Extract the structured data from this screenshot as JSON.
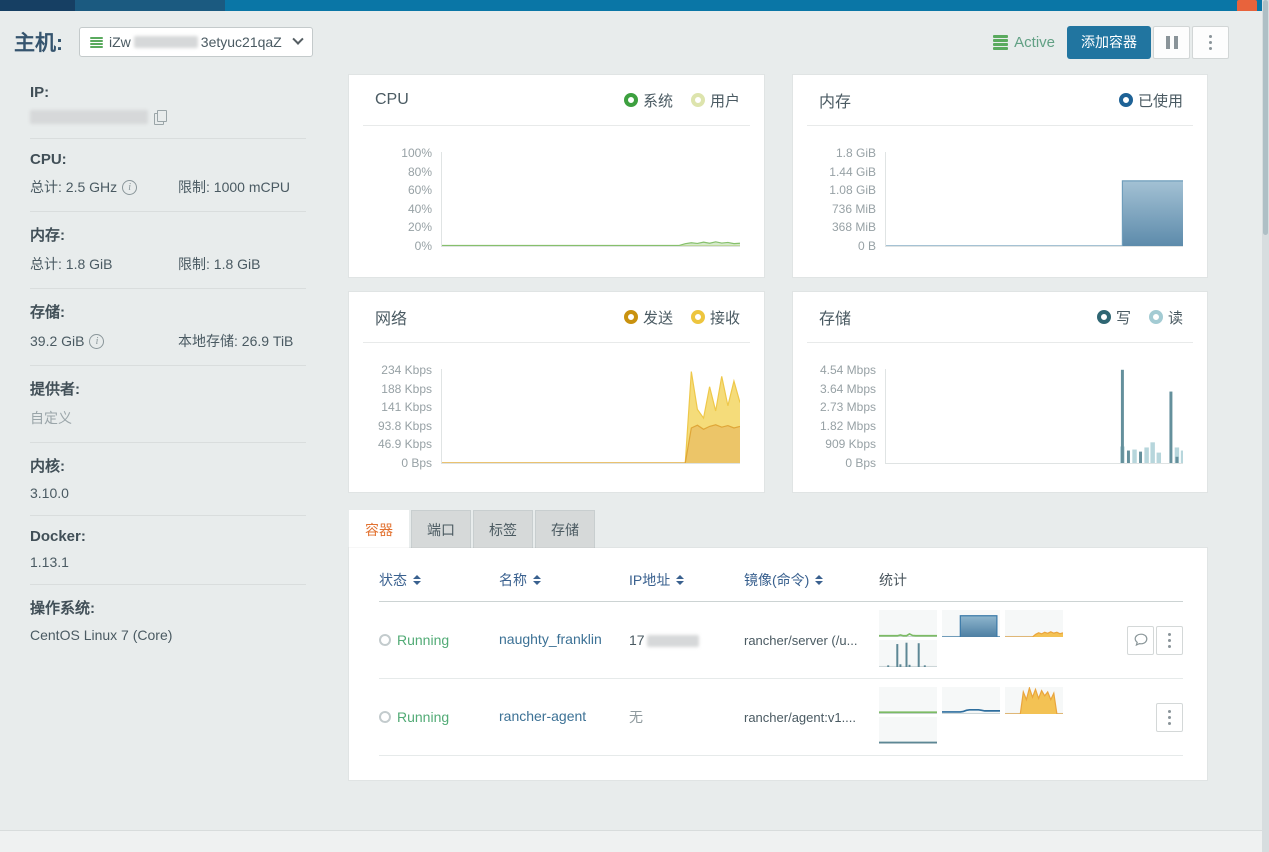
{
  "header": {
    "title": "主机:",
    "host_selector": {
      "icon": "host-stack-icon",
      "text_prefix": "iZw",
      "text_suffix": "3etyuc21qaZ"
    },
    "status_label": "Active",
    "add_container_label": "添加容器"
  },
  "sidebar": {
    "sections": [
      {
        "label": "IP:",
        "value1": "",
        "value2": ""
      },
      {
        "label": "CPU:",
        "value1": "总计: 2.5 GHz",
        "value2": "限制: 1000 mCPU"
      },
      {
        "label": "内存:",
        "value1": "总计: 1.8 GiB",
        "value2": "限制: 1.8 GiB"
      },
      {
        "label": "存储:",
        "value1": "39.2 GiB",
        "value2": "本地存储: 26.9 TiB"
      },
      {
        "label": "提供者:",
        "value1": "自定义",
        "value2": ""
      },
      {
        "label": "内核:",
        "value1": "3.10.0",
        "value2": ""
      },
      {
        "label": "Docker:",
        "value1": "1.13.1",
        "value2": ""
      },
      {
        "label": "操作系统:",
        "value1": "CentOS Linux 7 (Core)",
        "value2": ""
      }
    ]
  },
  "chart_data": [
    {
      "name": "cpu",
      "type": "area-line",
      "title": "CPU",
      "legend": [
        {
          "label": "系统",
          "color": "#3da03f"
        },
        {
          "label": "用户",
          "color": "#dde4ad"
        }
      ],
      "yticks": [
        "100%",
        "80%",
        "60%",
        "40%",
        "20%",
        "0%"
      ],
      "ymax": 100,
      "ylabel_unit": "%",
      "series": [
        {
          "name": "系统",
          "color": "#86c06c",
          "fill": "rgba(134,192,108,0.35)",
          "values": [
            0.6,
            0.6,
            0.6,
            0.6,
            0.6,
            0.6,
            0.6,
            0.6,
            0.6,
            0.6,
            0.6,
            0.6,
            0.6,
            0.6,
            0.6,
            0.6,
            0.6,
            0.6,
            0.6,
            0.6,
            0.6,
            0.6,
            0.6,
            0.6,
            0.6,
            0.6,
            0.6,
            0.6,
            0.6,
            0.6,
            0.6,
            0.6,
            0.6,
            0.6,
            0.6,
            0.6,
            0.6,
            0.6,
            0.6,
            0.6,
            2.5,
            3.5,
            2.8,
            4.2,
            3,
            4.5,
            3.2,
            3.8,
            2.6,
            3
          ]
        },
        {
          "name": "用户",
          "color": "#d7e3a8",
          "fill": "rgba(215,227,168,0.5)",
          "values": [
            0.3,
            0.3,
            0.3,
            0.3,
            0.3,
            0.3,
            0.3,
            0.3,
            0.3,
            0.3,
            0.3,
            0.3,
            0.3,
            0.3,
            0.3,
            0.3,
            0.3,
            0.3,
            0.3,
            0.3,
            0.3,
            0.3,
            0.3,
            0.3,
            0.3,
            0.3,
            0.3,
            0.3,
            0.3,
            0.3,
            0.3,
            0.3,
            0.3,
            0.3,
            0.3,
            0.3,
            0.3,
            0.3,
            0.3,
            0.3,
            0.3,
            0.3,
            0.3,
            0.3,
            0.3,
            0.3,
            0.3,
            0.3,
            0.3,
            0.3
          ]
        }
      ]
    },
    {
      "name": "memory",
      "type": "area",
      "title": "内存",
      "legend": [
        {
          "label": "已使用",
          "color": "#1e6296"
        }
      ],
      "yticks": [
        "1.8 GiB",
        "1.44 GiB",
        "1.08 GiB",
        "736 MiB",
        "368 MiB",
        "0 B"
      ],
      "ymax": 1843,
      "ylabel_unit": "MiB",
      "series": [
        {
          "name": "已使用",
          "color": "#6f9dbb",
          "fill": "gradient-blue",
          "step": true,
          "values": [
            0,
            0,
            0,
            0,
            0,
            0,
            0,
            0,
            0,
            0,
            0,
            0,
            0,
            0,
            0,
            0,
            0,
            0,
            0,
            0,
            0,
            0,
            0,
            0,
            0,
            0,
            0,
            0,
            0,
            0,
            0,
            0,
            0,
            0,
            0,
            0,
            0,
            0,
            0,
            1290,
            1290,
            1290,
            1290,
            1290,
            1290,
            1290,
            1290,
            1290,
            1290,
            1290
          ]
        }
      ]
    },
    {
      "name": "network",
      "type": "stacked-area",
      "title": "网络",
      "legend": [
        {
          "label": "发送",
          "color": "#c9920f"
        },
        {
          "label": "接收",
          "color": "#edc53e"
        }
      ],
      "yticks": [
        "234 Kbps",
        "188 Kbps",
        "141 Kbps",
        "93.8 Kbps",
        "46.9 Kbps",
        "0 Bps"
      ],
      "ymax": 234,
      "ylabel_unit": "Kbps",
      "series": [
        {
          "name": "发送",
          "color": "#dfa637",
          "fill": "#ecc568",
          "values": [
            0,
            0,
            0,
            0,
            0,
            0,
            0,
            0,
            0,
            0,
            0,
            0,
            0,
            0,
            0,
            0,
            0,
            0,
            0,
            0,
            0,
            0,
            0,
            0,
            0,
            0,
            0,
            0,
            0,
            0,
            0,
            0,
            0,
            0,
            0,
            0,
            0,
            0,
            0,
            0,
            0,
            88,
            95,
            85,
            92,
            96,
            90,
            94,
            88,
            92
          ]
        },
        {
          "name": "接收",
          "color": "#eec84a",
          "fill": "#f5dc7a",
          "values": [
            0,
            0,
            0,
            0,
            0,
            0,
            0,
            0,
            0,
            0,
            0,
            0,
            0,
            0,
            0,
            0,
            0,
            0,
            0,
            0,
            0,
            0,
            0,
            0,
            0,
            0,
            0,
            0,
            0,
            0,
            0,
            0,
            0,
            0,
            0,
            0,
            0,
            0,
            0,
            0,
            0,
            142,
            40,
            28,
            100,
            35,
            128,
            50,
            118,
            60
          ]
        }
      ]
    },
    {
      "name": "storage",
      "type": "spikes",
      "title": "存储",
      "legend": [
        {
          "label": "写",
          "color": "#2f6673"
        },
        {
          "label": "读",
          "color": "#a3cbd3"
        }
      ],
      "yticks": [
        "4.54 Mbps",
        "3.64 Mbps",
        "2.73 Mbps",
        "1.82 Mbps",
        "909 Kbps",
        "0 Bps"
      ],
      "ymax": 4.54,
      "ylabel_unit": "Mbps",
      "series": [
        {
          "name": "写",
          "color": "#64909c",
          "values": [
            0,
            0,
            0,
            0,
            0,
            0,
            0,
            0,
            0,
            0,
            0,
            0,
            0,
            0,
            0,
            0,
            0,
            0,
            0,
            0,
            0,
            0,
            0,
            0,
            0,
            0,
            0,
            0,
            0,
            0,
            0,
            0,
            0,
            0,
            0,
            0,
            0,
            0,
            0,
            4.5,
            0.6,
            0,
            0.55,
            0,
            0,
            0,
            0,
            3.45,
            0.3,
            0
          ]
        },
        {
          "name": "读",
          "color": "#b7d6dc",
          "values": [
            0,
            0,
            0,
            0,
            0,
            0,
            0,
            0,
            0,
            0,
            0,
            0,
            0,
            0,
            0,
            0,
            0,
            0,
            0,
            0,
            0,
            0,
            0,
            0,
            0,
            0,
            0,
            0,
            0,
            0,
            0,
            0,
            0,
            0,
            0,
            0,
            0,
            0,
            0,
            0.8,
            0,
            0.65,
            0,
            0.75,
            1.0,
            0.5,
            0,
            0,
            0.75,
            0.6
          ]
        }
      ]
    }
  ],
  "tabs": [
    {
      "label": "容器",
      "active": true
    },
    {
      "label": "端口",
      "active": false
    },
    {
      "label": "标签",
      "active": false
    },
    {
      "label": "存储",
      "active": false
    }
  ],
  "table": {
    "headers": [
      {
        "label": "状态",
        "sortable": true
      },
      {
        "label": "名称",
        "sortable": true
      },
      {
        "label": "IP地址",
        "sortable": true
      },
      {
        "label": "镜像(命令)",
        "sortable": true
      },
      {
        "label": "统计",
        "sortable": false
      }
    ],
    "rows": [
      {
        "status": "Running",
        "name": "naughty_franklin",
        "ip_prefix": "17",
        "ip_redacted": true,
        "image": "rancher/server (/u...",
        "actions": [
          "console",
          "menu"
        ],
        "sparklines": [
          {
            "kind": "cpu",
            "type": "line",
            "color": "#7cbb64",
            "values": [
              0.05,
              0.05,
              0.05,
              0.05,
              0.05,
              0.05,
              0.05,
              0.08,
              0.05,
              0.05,
              0.12,
              0.06,
              0.05,
              0.05,
              0.05,
              0.05,
              0.05,
              0.05,
              0.05,
              0.05
            ]
          },
          {
            "kind": "memory",
            "type": "block",
            "fill": "gradient-blue",
            "stroke": "#3a79a8",
            "step": true,
            "values": [
              0,
              0,
              0,
              0,
              0,
              0,
              0.82,
              0.82,
              0.82,
              0.82,
              0.82,
              0.82,
              0.82,
              0.82,
              0.82,
              0.82,
              0.82,
              0.82,
              0,
              0
            ]
          },
          {
            "kind": "network",
            "type": "area",
            "color": "#eaa53d",
            "fill": "#f3c254",
            "values": [
              0,
              0,
              0,
              0,
              0,
              0,
              0,
              0,
              0,
              0,
              0.1,
              0.16,
              0.12,
              0.18,
              0.14,
              0.2,
              0.15,
              0.18,
              0.13,
              0.16
            ]
          },
          {
            "kind": "storage",
            "type": "bars",
            "color": "#5d8795",
            "values": [
              0,
              0,
              0,
              0.06,
              0,
              0,
              0.85,
              0.1,
              0,
              0.9,
              0.08,
              0,
              0,
              0.88,
              0,
              0.06,
              0,
              0,
              0,
              0
            ]
          }
        ]
      },
      {
        "status": "Running",
        "name": "rancher-agent",
        "ip_prefix": "无",
        "ip_redacted": false,
        "image": "rancher/agent:v1....",
        "actions": [
          "menu"
        ],
        "sparklines": [
          {
            "kind": "cpu",
            "type": "line",
            "color": "#7cbb64",
            "values": [
              0.07,
              0.07,
              0.07,
              0.07,
              0.07,
              0.07,
              0.07,
              0.07,
              0.07,
              0.07,
              0.07,
              0.07,
              0.07,
              0.07,
              0.07,
              0.07,
              0.07,
              0.07,
              0.07,
              0.07
            ]
          },
          {
            "kind": "memory",
            "type": "line",
            "color": "#2e6e9e",
            "values": [
              0.08,
              0.08,
              0.08,
              0.08,
              0.08,
              0.08,
              0.08,
              0.1,
              0.14,
              0.16,
              0.16,
              0.16,
              0.16,
              0.14,
              0.12,
              0.12,
              0.12,
              0.12,
              0.12,
              0.12
            ]
          },
          {
            "kind": "network",
            "type": "area",
            "color": "#eaa53d",
            "fill": "#f3c254",
            "values": [
              0,
              0,
              0,
              0,
              0,
              0,
              0.85,
              0.55,
              1,
              0.65,
              0.95,
              0.6,
              0.9,
              0.7,
              0.85,
              0.55,
              0.8,
              0,
              0,
              0
            ]
          },
          {
            "kind": "storage",
            "type": "line",
            "color": "#5d8795",
            "values": [
              0.06,
              0.06,
              0.06,
              0.06,
              0.06,
              0.06,
              0.06,
              0.06,
              0.06,
              0.06,
              0.06,
              0.06,
              0.06,
              0.06,
              0.06,
              0.06,
              0.06,
              0.06,
              0.06,
              0.06
            ]
          }
        ]
      }
    ]
  }
}
